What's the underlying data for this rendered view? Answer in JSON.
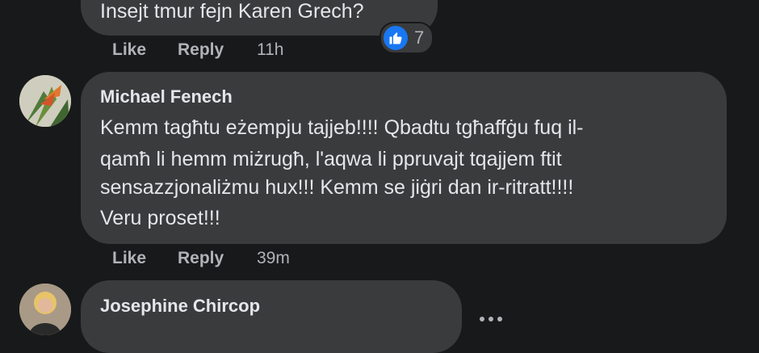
{
  "comment1": {
    "text": "Insejt tmur fejn Karen Grech?",
    "like_label": "Like",
    "reply_label": "Reply",
    "time": "11h",
    "reaction_icon": "like-icon",
    "reaction_count": "7",
    "accent": "#1877f2"
  },
  "comment2": {
    "author": "Michael Fenech",
    "lines": [
      "Kemm tagħtu eżempju tajjeb!!!! Qbadtu tgħaffġu fuq il-",
      "qamħ li hemm miżrugħ, l'aqwa li ppruvajt tqajjem ftit",
      "sensazzjonaliżmu hux!!! Kemm se jiġri dan ir-ritratt!!!!",
      "Veru proset!!!"
    ],
    "like_label": "Like",
    "reply_label": "Reply",
    "time": "39m"
  },
  "comment3": {
    "author": "Josephine Chircop",
    "more_icon": "more-options-icon"
  },
  "colors": {
    "background": "#18191a",
    "bubble": "#3a3b3c",
    "text": "#e4e6eb",
    "secondary": "#b0b3b8"
  }
}
